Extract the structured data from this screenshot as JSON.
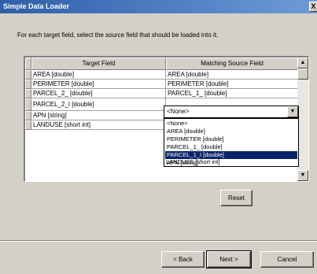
{
  "window": {
    "title": "Simple Data Loader",
    "close_label": "X"
  },
  "instruction": "For each target field, select the source field that should be loaded into it.",
  "grid": {
    "columns": [
      "Target Field",
      "Matching Source Field"
    ],
    "rows": [
      {
        "target": "AREA [double]",
        "source": "AREA [double]"
      },
      {
        "target": "PERIMETER [double]",
        "source": "PERIMETER [double]"
      },
      {
        "target": "PARCEL_2_ [double]",
        "source": "PARCEL_1_ [double]"
      },
      {
        "target": "PARCEL_2_I [double]",
        "source": ""
      },
      {
        "target": "APN [string]",
        "source": ""
      },
      {
        "target": "LANDUSE [short int]",
        "source": ""
      }
    ]
  },
  "combo": {
    "value": "<None>",
    "options": [
      "<None>",
      "AREA [double]",
      "PERIMETER [double]",
      "PARCEL_1_ [double]",
      "PARCEL_1_I [double]",
      "APN [string]",
      "LANDUSE [short int]"
    ],
    "highlighted": "PARCEL_1_I [double]"
  },
  "icons": {
    "scroll_up": "triangle-up-icon",
    "scroll_down": "triangle-down-icon",
    "dropdown": "triangle-down-icon"
  },
  "buttons": {
    "reset": "Reset",
    "back": "< Back",
    "next": "Next >",
    "cancel": "Cancel"
  }
}
